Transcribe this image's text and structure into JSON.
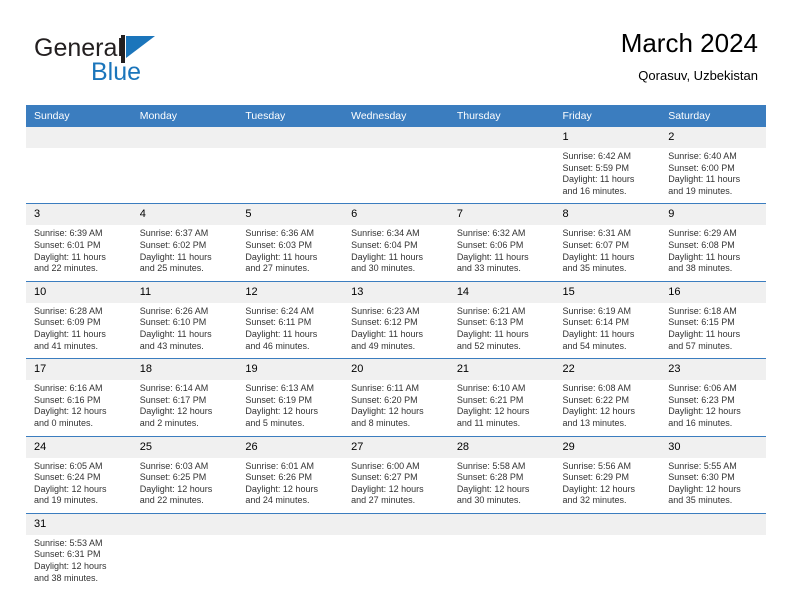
{
  "brand": {
    "name_top": "General",
    "name_bottom": "Blue",
    "color_black": "#231f20",
    "color_blue": "#1b75bb"
  },
  "header": {
    "title": "March 2024",
    "subtitle": "Qorasuv, Uzbekistan"
  },
  "theme": {
    "header_bg": "#3b7dbf",
    "header_text": "#ffffff",
    "daynum_bg": "#f0f0f0",
    "row_divider": "#3b7dbf",
    "body_text": "#333333"
  },
  "calendar": {
    "weekday_headers": [
      "Sunday",
      "Monday",
      "Tuesday",
      "Wednesday",
      "Thursday",
      "Friday",
      "Saturday"
    ],
    "weeks": [
      [
        {
          "day": "",
          "lines": []
        },
        {
          "day": "",
          "lines": []
        },
        {
          "day": "",
          "lines": []
        },
        {
          "day": "",
          "lines": []
        },
        {
          "day": "",
          "lines": []
        },
        {
          "day": "1",
          "lines": [
            "Sunrise: 6:42 AM",
            "Sunset: 5:59 PM",
            "Daylight: 11 hours",
            "and 16 minutes."
          ]
        },
        {
          "day": "2",
          "lines": [
            "Sunrise: 6:40 AM",
            "Sunset: 6:00 PM",
            "Daylight: 11 hours",
            "and 19 minutes."
          ]
        }
      ],
      [
        {
          "day": "3",
          "lines": [
            "Sunrise: 6:39 AM",
            "Sunset: 6:01 PM",
            "Daylight: 11 hours",
            "and 22 minutes."
          ]
        },
        {
          "day": "4",
          "lines": [
            "Sunrise: 6:37 AM",
            "Sunset: 6:02 PM",
            "Daylight: 11 hours",
            "and 25 minutes."
          ]
        },
        {
          "day": "5",
          "lines": [
            "Sunrise: 6:36 AM",
            "Sunset: 6:03 PM",
            "Daylight: 11 hours",
            "and 27 minutes."
          ]
        },
        {
          "day": "6",
          "lines": [
            "Sunrise: 6:34 AM",
            "Sunset: 6:04 PM",
            "Daylight: 11 hours",
            "and 30 minutes."
          ]
        },
        {
          "day": "7",
          "lines": [
            "Sunrise: 6:32 AM",
            "Sunset: 6:06 PM",
            "Daylight: 11 hours",
            "and 33 minutes."
          ]
        },
        {
          "day": "8",
          "lines": [
            "Sunrise: 6:31 AM",
            "Sunset: 6:07 PM",
            "Daylight: 11 hours",
            "and 35 minutes."
          ]
        },
        {
          "day": "9",
          "lines": [
            "Sunrise: 6:29 AM",
            "Sunset: 6:08 PM",
            "Daylight: 11 hours",
            "and 38 minutes."
          ]
        }
      ],
      [
        {
          "day": "10",
          "lines": [
            "Sunrise: 6:28 AM",
            "Sunset: 6:09 PM",
            "Daylight: 11 hours",
            "and 41 minutes."
          ]
        },
        {
          "day": "11",
          "lines": [
            "Sunrise: 6:26 AM",
            "Sunset: 6:10 PM",
            "Daylight: 11 hours",
            "and 43 minutes."
          ]
        },
        {
          "day": "12",
          "lines": [
            "Sunrise: 6:24 AM",
            "Sunset: 6:11 PM",
            "Daylight: 11 hours",
            "and 46 minutes."
          ]
        },
        {
          "day": "13",
          "lines": [
            "Sunrise: 6:23 AM",
            "Sunset: 6:12 PM",
            "Daylight: 11 hours",
            "and 49 minutes."
          ]
        },
        {
          "day": "14",
          "lines": [
            "Sunrise: 6:21 AM",
            "Sunset: 6:13 PM",
            "Daylight: 11 hours",
            "and 52 minutes."
          ]
        },
        {
          "day": "15",
          "lines": [
            "Sunrise: 6:19 AM",
            "Sunset: 6:14 PM",
            "Daylight: 11 hours",
            "and 54 minutes."
          ]
        },
        {
          "day": "16",
          "lines": [
            "Sunrise: 6:18 AM",
            "Sunset: 6:15 PM",
            "Daylight: 11 hours",
            "and 57 minutes."
          ]
        }
      ],
      [
        {
          "day": "17",
          "lines": [
            "Sunrise: 6:16 AM",
            "Sunset: 6:16 PM",
            "Daylight: 12 hours",
            "and 0 minutes."
          ]
        },
        {
          "day": "18",
          "lines": [
            "Sunrise: 6:14 AM",
            "Sunset: 6:17 PM",
            "Daylight: 12 hours",
            "and 2 minutes."
          ]
        },
        {
          "day": "19",
          "lines": [
            "Sunrise: 6:13 AM",
            "Sunset: 6:19 PM",
            "Daylight: 12 hours",
            "and 5 minutes."
          ]
        },
        {
          "day": "20",
          "lines": [
            "Sunrise: 6:11 AM",
            "Sunset: 6:20 PM",
            "Daylight: 12 hours",
            "and 8 minutes."
          ]
        },
        {
          "day": "21",
          "lines": [
            "Sunrise: 6:10 AM",
            "Sunset: 6:21 PM",
            "Daylight: 12 hours",
            "and 11 minutes."
          ]
        },
        {
          "day": "22",
          "lines": [
            "Sunrise: 6:08 AM",
            "Sunset: 6:22 PM",
            "Daylight: 12 hours",
            "and 13 minutes."
          ]
        },
        {
          "day": "23",
          "lines": [
            "Sunrise: 6:06 AM",
            "Sunset: 6:23 PM",
            "Daylight: 12 hours",
            "and 16 minutes."
          ]
        }
      ],
      [
        {
          "day": "24",
          "lines": [
            "Sunrise: 6:05 AM",
            "Sunset: 6:24 PM",
            "Daylight: 12 hours",
            "and 19 minutes."
          ]
        },
        {
          "day": "25",
          "lines": [
            "Sunrise: 6:03 AM",
            "Sunset: 6:25 PM",
            "Daylight: 12 hours",
            "and 22 minutes."
          ]
        },
        {
          "day": "26",
          "lines": [
            "Sunrise: 6:01 AM",
            "Sunset: 6:26 PM",
            "Daylight: 12 hours",
            "and 24 minutes."
          ]
        },
        {
          "day": "27",
          "lines": [
            "Sunrise: 6:00 AM",
            "Sunset: 6:27 PM",
            "Daylight: 12 hours",
            "and 27 minutes."
          ]
        },
        {
          "day": "28",
          "lines": [
            "Sunrise: 5:58 AM",
            "Sunset: 6:28 PM",
            "Daylight: 12 hours",
            "and 30 minutes."
          ]
        },
        {
          "day": "29",
          "lines": [
            "Sunrise: 5:56 AM",
            "Sunset: 6:29 PM",
            "Daylight: 12 hours",
            "and 32 minutes."
          ]
        },
        {
          "day": "30",
          "lines": [
            "Sunrise: 5:55 AM",
            "Sunset: 6:30 PM",
            "Daylight: 12 hours",
            "and 35 minutes."
          ]
        }
      ],
      [
        {
          "day": "31",
          "lines": [
            "Sunrise: 5:53 AM",
            "Sunset: 6:31 PM",
            "Daylight: 12 hours",
            "and 38 minutes."
          ]
        },
        {
          "day": "",
          "lines": []
        },
        {
          "day": "",
          "lines": []
        },
        {
          "day": "",
          "lines": []
        },
        {
          "day": "",
          "lines": []
        },
        {
          "day": "",
          "lines": []
        },
        {
          "day": "",
          "lines": []
        }
      ]
    ]
  }
}
